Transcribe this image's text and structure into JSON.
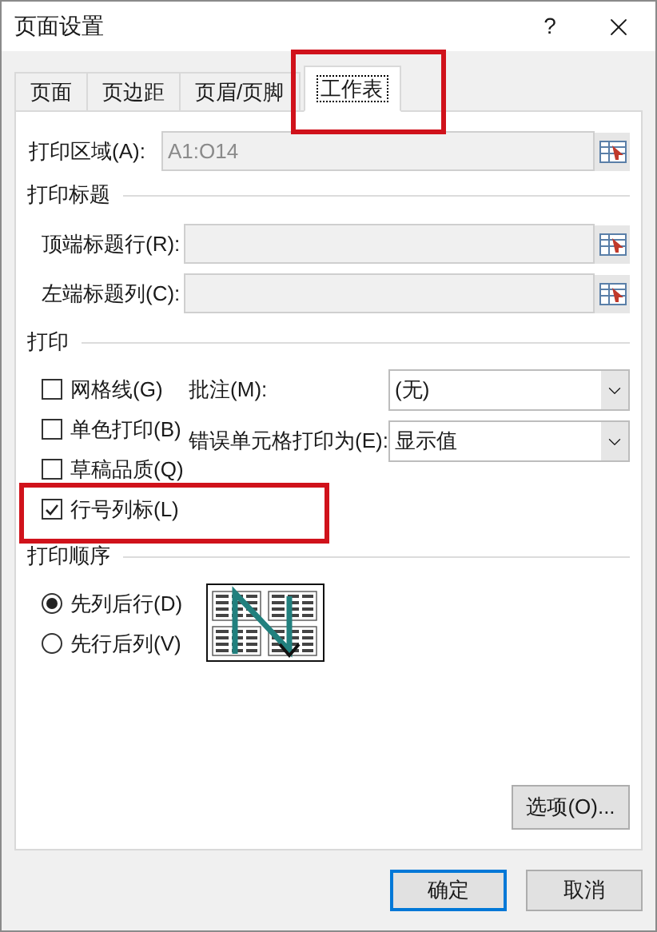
{
  "window": {
    "title": "页面设置",
    "help": "?"
  },
  "tabs": [
    {
      "label": "页面",
      "selected": false,
      "highlight": false
    },
    {
      "label": "页边距",
      "selected": false,
      "highlight": false
    },
    {
      "label": "页眉/页脚",
      "selected": false,
      "highlight": false
    },
    {
      "label": "工作表",
      "selected": true,
      "highlight": true
    }
  ],
  "print_area": {
    "label": "打印区域(A):",
    "value": "A1:O14"
  },
  "print_titles": {
    "heading": "打印标题",
    "fields": [
      {
        "label": "顶端标题行(R):"
      },
      {
        "label": "左端标题列(C):"
      }
    ]
  },
  "print": {
    "heading": "打印",
    "checkboxes": [
      {
        "label": "网格线(G)",
        "checked": false,
        "highlight": false
      },
      {
        "label": "单色打印(B)",
        "checked": false,
        "highlight": false
      },
      {
        "label": "草稿品质(Q)",
        "checked": false,
        "highlight": false
      },
      {
        "label": "行号列标(L)",
        "checked": true,
        "highlight": true
      }
    ],
    "dropdowns": [
      {
        "label": "批注(M):",
        "value": "(无)"
      },
      {
        "label": "错误单元格打印为(E):",
        "value": "显示值"
      }
    ]
  },
  "page_order": {
    "heading": "打印顺序",
    "radios": [
      {
        "label": "先列后行(D)",
        "selected": true
      },
      {
        "label": "先行后列(V)",
        "selected": false
      }
    ]
  },
  "options_button": "选项(O)...",
  "buttons": [
    {
      "label": "确定",
      "default": true
    },
    {
      "label": "取消",
      "default": false
    }
  ]
}
